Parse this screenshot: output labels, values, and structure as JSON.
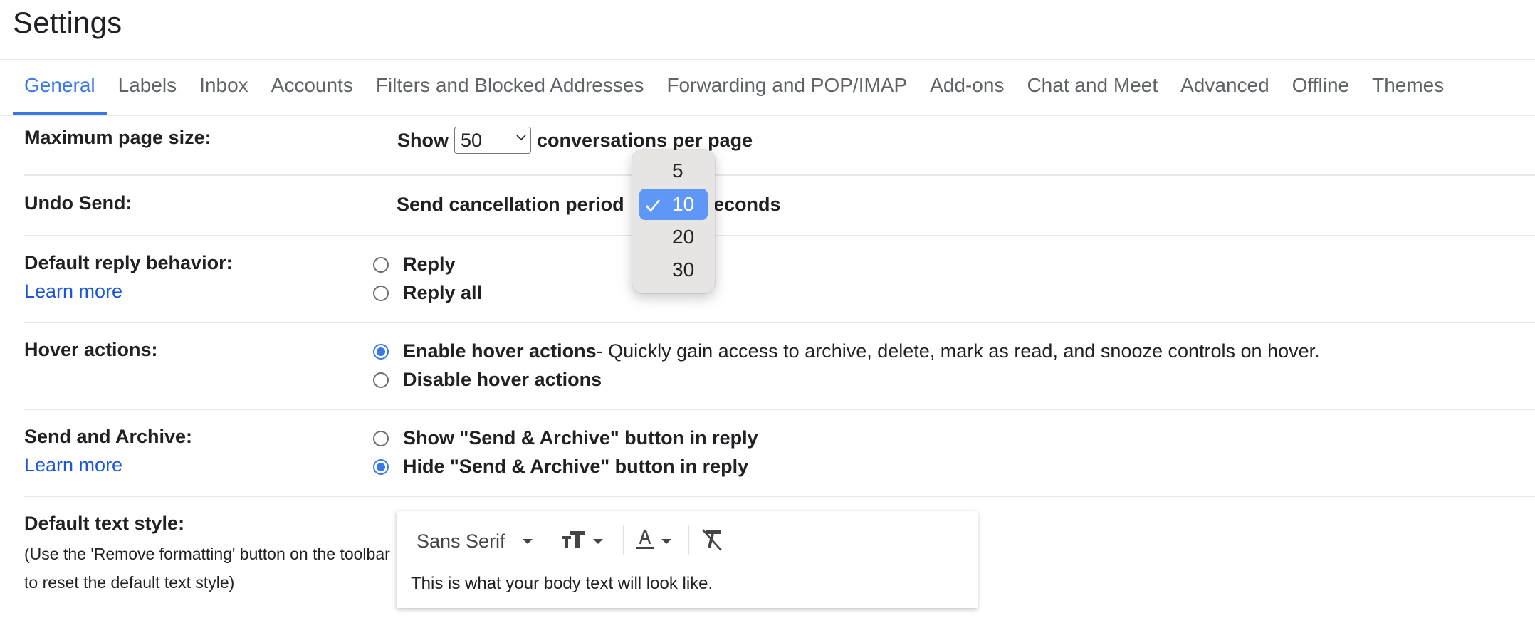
{
  "page": {
    "title": "Settings"
  },
  "tabs": [
    {
      "label": "General",
      "active": true
    },
    {
      "label": "Labels",
      "active": false
    },
    {
      "label": "Inbox",
      "active": false
    },
    {
      "label": "Accounts",
      "active": false
    },
    {
      "label": "Filters and Blocked Addresses",
      "active": false
    },
    {
      "label": "Forwarding and POP/IMAP",
      "active": false
    },
    {
      "label": "Add-ons",
      "active": false
    },
    {
      "label": "Chat and Meet",
      "active": false
    },
    {
      "label": "Advanced",
      "active": false
    },
    {
      "label": "Offline",
      "active": false
    },
    {
      "label": "Themes",
      "active": false
    }
  ],
  "settings": {
    "max_page_size": {
      "label": "Maximum page size:",
      "prefix": "Show",
      "value": "50",
      "suffix": "conversations per page"
    },
    "undo_send": {
      "label": "Undo Send:",
      "prefix": "Send cancellation period",
      "suffix_visible": "econds",
      "dropdown_options": [
        "5",
        "10",
        "20",
        "30"
      ],
      "selected": "10"
    },
    "default_reply": {
      "label": "Default reply behavior:",
      "link": "Learn more",
      "options": [
        {
          "label": "Reply",
          "checked": false
        },
        {
          "label": "Reply all",
          "checked": false
        }
      ]
    },
    "hover_actions": {
      "label": "Hover actions:",
      "options": [
        {
          "label": "Enable hover actions",
          "desc": " - Quickly gain access to archive, delete, mark as read, and snooze controls on hover.",
          "checked": true
        },
        {
          "label": "Disable hover actions",
          "checked": false
        }
      ]
    },
    "send_archive": {
      "label": "Send and Archive:",
      "link": "Learn more",
      "options": [
        {
          "label": "Show \"Send & Archive\" button in reply",
          "checked": false
        },
        {
          "label": "Hide \"Send & Archive\" button in reply",
          "checked": true
        }
      ]
    },
    "text_style": {
      "label": "Default text style:",
      "note": "(Use the 'Remove formatting' button on the toolbar to reset the default text style)",
      "font": "Sans Serif",
      "preview": "This is what your body text will look like.",
      "icons": [
        "font-size-icon",
        "text-color-icon",
        "remove-formatting-icon"
      ]
    }
  },
  "colors": {
    "accent": "#3b78e7",
    "link": "#1a56d6",
    "dropdown_selected": "#5f97f6"
  }
}
